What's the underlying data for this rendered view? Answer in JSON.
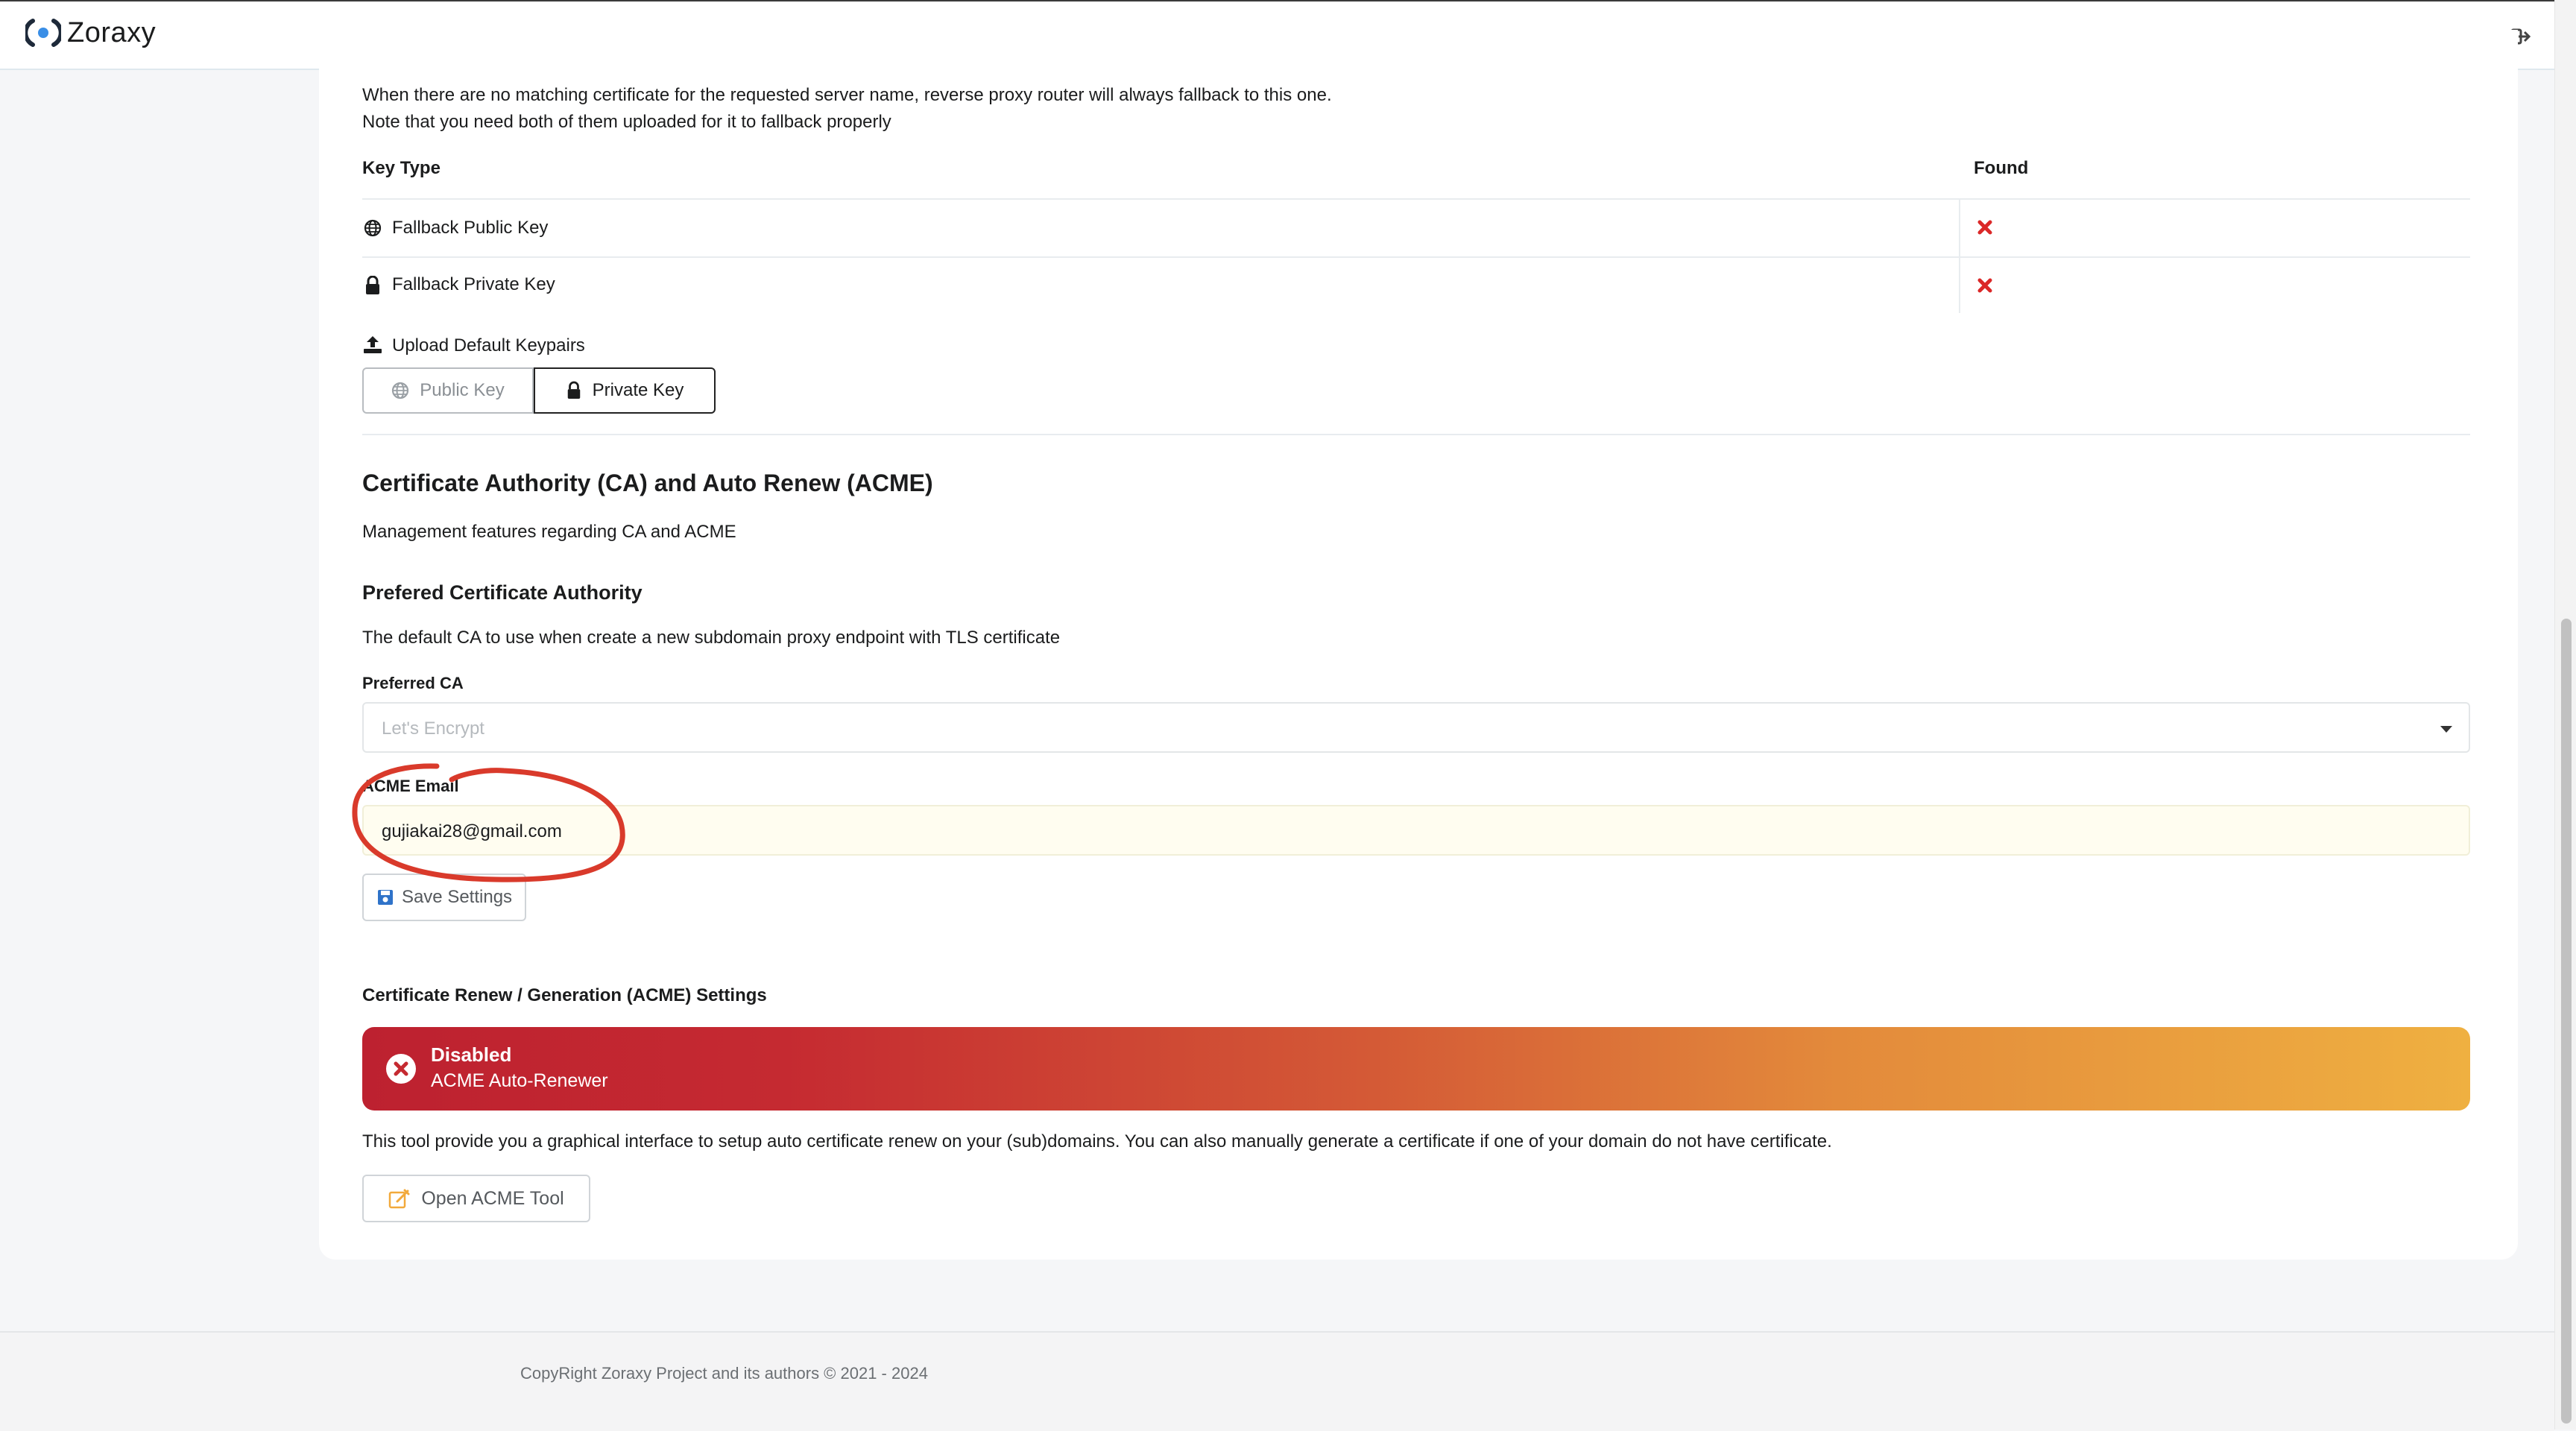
{
  "app": {
    "title": "Zoraxy"
  },
  "fallback": {
    "description_line1": "When there are no matching certificate for the requested server name, reverse proxy router will always fallback to this one.",
    "description_line2": "Note that you need both of them uploaded for it to fallback properly",
    "table": {
      "headers": [
        "Key Type",
        "Found"
      ],
      "rows": [
        {
          "label": "Fallback Public Key",
          "icon": "globe-icon",
          "found": "x-mark"
        },
        {
          "label": "Fallback Private Key",
          "icon": "lock-icon",
          "found": "x-mark"
        }
      ]
    },
    "upload_label": "Upload Default Keypairs",
    "public_key_button": "Public Key",
    "private_key_button": "Private Key"
  },
  "ca_section": {
    "title": "Certificate Authority (CA) and Auto Renew (ACME)",
    "description": "Management features regarding CA and ACME",
    "preferred_title": "Prefered Certificate Authority",
    "preferred_desc": "The default CA to use when create a new subdomain proxy endpoint with TLS certificate",
    "preferred_ca_label": "Preferred CA",
    "preferred_ca_placeholder": "Let's Encrypt",
    "acme_email_label": "ACME Email",
    "acme_email_value": "gujiakai28@gmail.com",
    "save_button": "Save Settings"
  },
  "renew_section": {
    "title": "Certificate Renew / Generation (ACME) Settings",
    "status_title": "Disabled",
    "status_sub": "ACME Auto-Renewer",
    "description": "This tool provide you a graphical interface to setup auto certificate renew on your (sub)domains. You can also manually generate a certificate if one of your domain do not have certificate.",
    "open_button": "Open ACME Tool"
  },
  "footer": {
    "copyright": "CopyRight Zoraxy Project and its authors © 2021 - 2024"
  },
  "colors": {
    "error_red": "#db2828",
    "banner_start": "#bd2130",
    "banner_end": "#efb041",
    "annotation_red": "#d93a2b"
  }
}
